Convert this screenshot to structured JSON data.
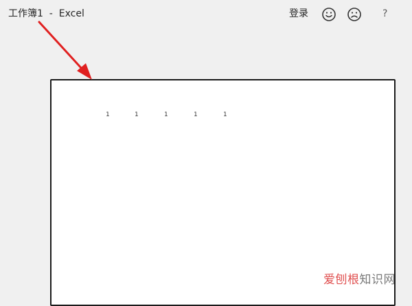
{
  "window": {
    "title": "工作簿1  -  Excel"
  },
  "titlebar": {
    "signin_label": "登录",
    "help_label": "?"
  },
  "icons": {
    "smile": "smile-icon",
    "frown": "frown-icon"
  },
  "sheet": {
    "row1": [
      "1",
      "1",
      "1",
      "1",
      "1"
    ]
  },
  "watermark": {
    "part1": "爱刨根",
    "part2": "知识网"
  },
  "colors": {
    "background": "#f0f0f0",
    "arrow": "#e02020",
    "page_border": "#1a1a1a"
  }
}
